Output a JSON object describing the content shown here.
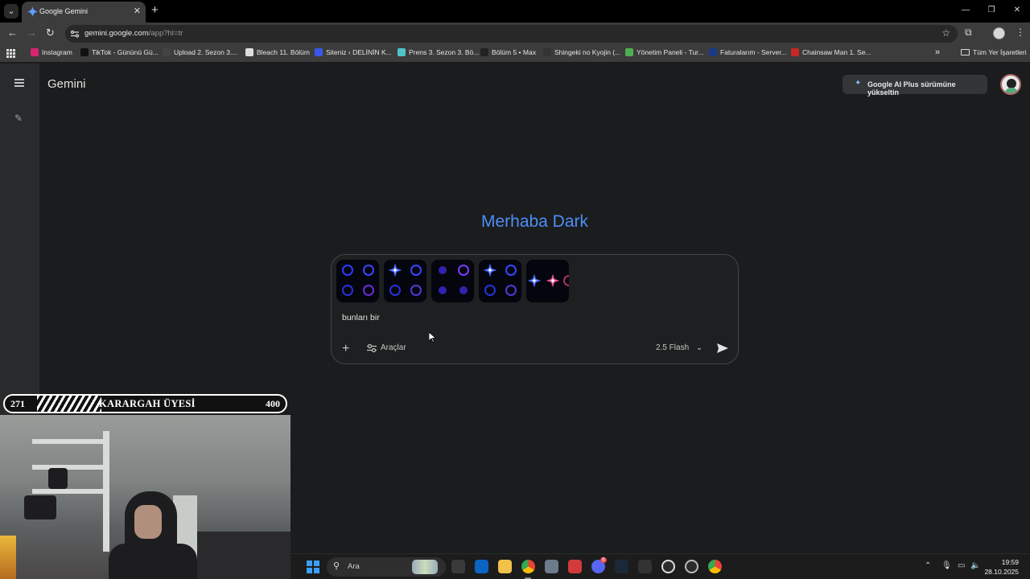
{
  "browser": {
    "tab_title": "Google Gemini",
    "url_host": "gemini.google.com",
    "url_path": "/app?hl=tr",
    "bookmarks": [
      {
        "label": "Instagram",
        "icon": "instagram-icon",
        "color": "#d6246e"
      },
      {
        "label": "TikTok - Gününü Gü...",
        "icon": "tiktok-icon",
        "color": "#111111"
      },
      {
        "label": "Upload 2. Sezon 3....",
        "icon": "dy-icon",
        "color": "#444444"
      },
      {
        "label": "Bleach 11. Bölüm",
        "icon": "bleach-icon",
        "color": "#dddddd"
      },
      {
        "label": "Siteniz ‹ DELİNİN K...",
        "icon": "wordpress-icon",
        "color": "#3858e9"
      },
      {
        "label": "Prens 3. Sezon 3. Bö...",
        "icon": "prens-icon",
        "color": "#4fc3c7"
      },
      {
        "label": "Bölüm 5 • Max",
        "icon": "max-icon",
        "color": "#222222"
      },
      {
        "label": "Shingeki no Kyojin (...",
        "icon": "shingeki-icon",
        "color": "#333333"
      },
      {
        "label": "Yönetim Paneli - Tur...",
        "icon": "panel-icon",
        "color": "#4caf50"
      },
      {
        "label": "Faturalarım - Server...",
        "icon": "invoice-icon",
        "color": "#1a3a8a"
      },
      {
        "label": "Chainsaw Man 1. Se...",
        "icon": "chainsaw-icon",
        "color": "#c62828"
      }
    ],
    "all_bookmarks": "Tüm Yer İşaretleri"
  },
  "gemini": {
    "brand": "Gemini",
    "upgrade_label": "Google AI Plus sürümüne yükseltin",
    "greeting": "Merhaba Dark",
    "prompt_text": "bunları bir",
    "tools_label": "Araçlar",
    "model_label": "2.5 Flash",
    "accent_color": "#4d8ef7",
    "attachments": [
      "image-1",
      "image-2",
      "image-3",
      "image-4",
      "image-5"
    ]
  },
  "overlay": {
    "left_number": "271",
    "title": "KARARGAH ÜYESİ",
    "right_number": "400"
  },
  "taskbar": {
    "search_label": "Ara",
    "time": "19:59",
    "date": "28.10.2025",
    "discord_badge": "6"
  }
}
